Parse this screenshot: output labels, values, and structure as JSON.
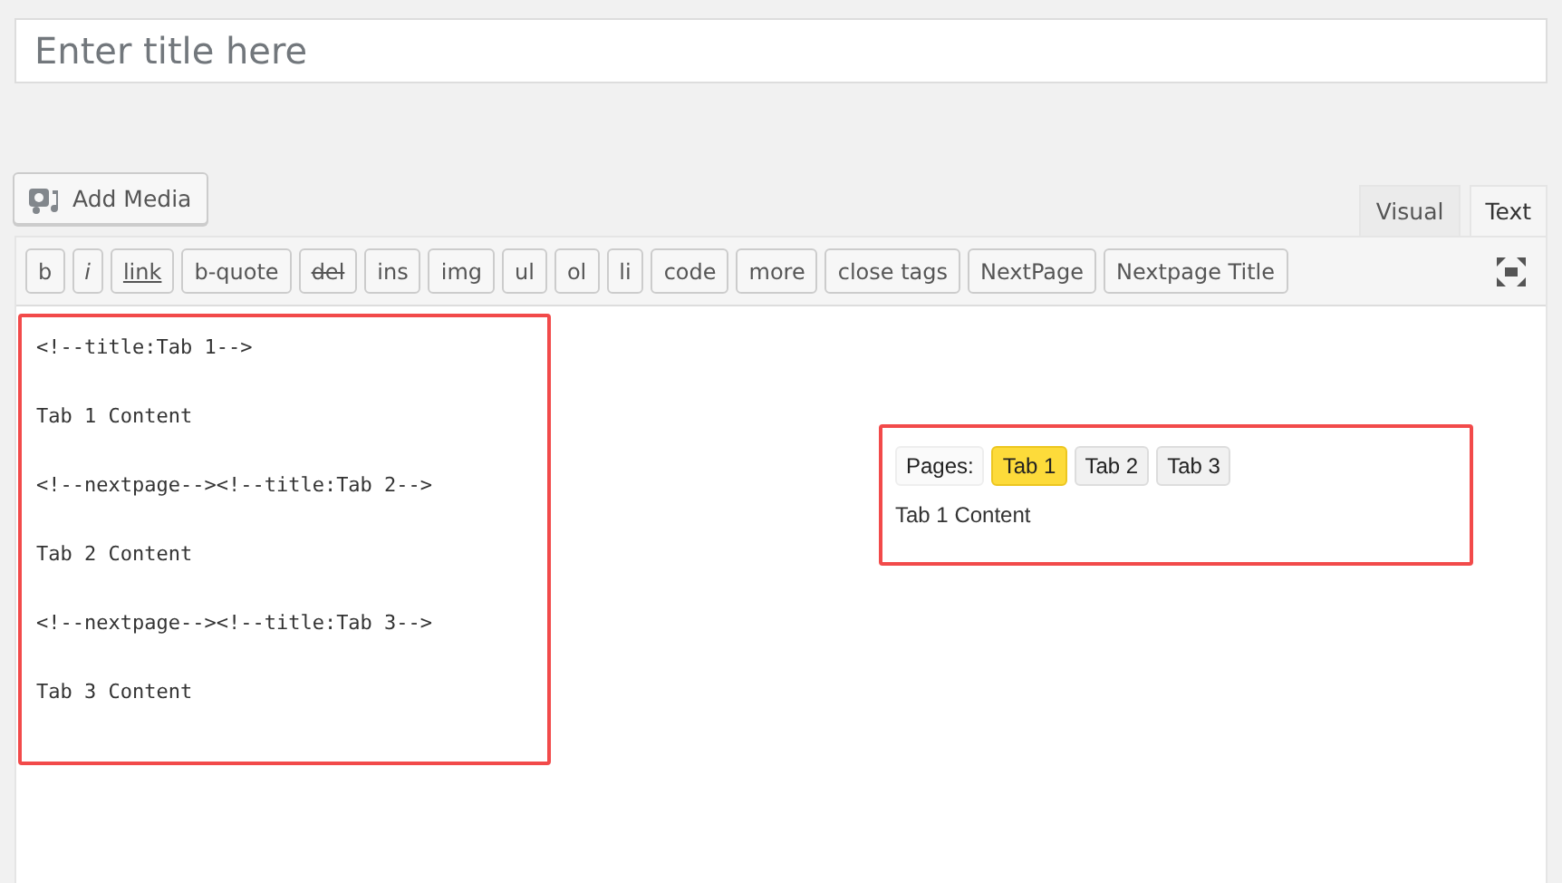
{
  "title_field": {
    "placeholder": "Enter title here"
  },
  "add_media_button": "Add Media",
  "editor_tabs": [
    {
      "label": "Visual",
      "selected": false
    },
    {
      "label": "Text",
      "selected": true
    }
  ],
  "toolbar": [
    {
      "label": "b",
      "kind": "plain"
    },
    {
      "label": "i",
      "kind": "italic"
    },
    {
      "label": "link",
      "kind": "underline"
    },
    {
      "label": "b-quote",
      "kind": "plain"
    },
    {
      "label": "del",
      "kind": "strike"
    },
    {
      "label": "ins",
      "kind": "plain"
    },
    {
      "label": "img",
      "kind": "plain"
    },
    {
      "label": "ul",
      "kind": "plain"
    },
    {
      "label": "ol",
      "kind": "plain"
    },
    {
      "label": "li",
      "kind": "plain"
    },
    {
      "label": "code",
      "kind": "plain"
    },
    {
      "label": "more",
      "kind": "plain"
    },
    {
      "label": "close tags",
      "kind": "plain"
    },
    {
      "label": "NextPage",
      "kind": "plain"
    },
    {
      "label": "Nextpage Title",
      "kind": "plain"
    }
  ],
  "editor_lines": [
    "<!--title:Tab 1-->",
    "Tab 1 Content",
    "<!--nextpage--><!--title:Tab 2-->",
    "Tab 2 Content",
    "<!--nextpage--><!--title:Tab 3-->",
    "Tab 3 Content"
  ],
  "preview": {
    "pages_label": "Pages:",
    "tabs": [
      {
        "label": "Tab 1",
        "selected": true
      },
      {
        "label": "Tab 2",
        "selected": false
      },
      {
        "label": "Tab 3",
        "selected": false
      }
    ],
    "content": "Tab 1 Content"
  }
}
